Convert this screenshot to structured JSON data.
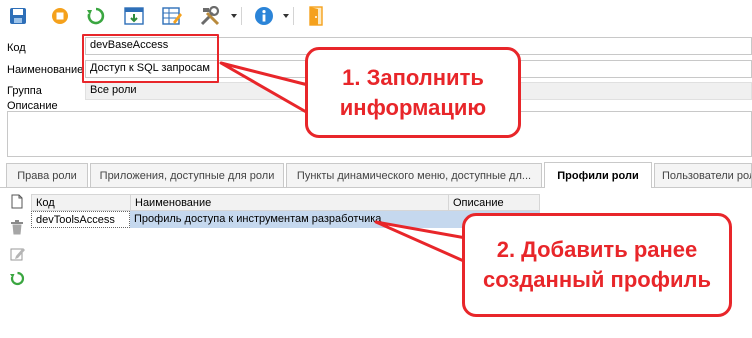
{
  "toolbar": {
    "buttons": [
      {
        "name": "save-icon",
        "color": "#2e6fb8"
      },
      {
        "name": "stop-icon",
        "color": "#f5a11c"
      },
      {
        "name": "refresh-icon",
        "color": "#3aa640"
      },
      {
        "name": "import-icon",
        "color": "#2e8a3a"
      },
      {
        "name": "edit-table-icon",
        "color": "#2e6fb8"
      },
      {
        "name": "tools-icon",
        "color": "#6b6b6b"
      },
      {
        "name": "info-icon",
        "color": "#2b84d8"
      },
      {
        "name": "exit-door-icon",
        "color": "#f5a11c"
      }
    ]
  },
  "form": {
    "code_label": "Код",
    "code_value": "devBaseAccess",
    "name_label": "Наименование",
    "name_value": "Доступ к SQL запросам",
    "group_label": "Группа",
    "group_value": "Все роли",
    "description_label": "Описание",
    "description_value": ""
  },
  "tabs": [
    {
      "label": "Права роли",
      "active": false
    },
    {
      "label": "Приложения, доступные для роли",
      "active": false
    },
    {
      "label": "Пункты динамического меню, доступные дл...",
      "active": false
    },
    {
      "label": "Профили роли",
      "active": true
    },
    {
      "label": "Пользователи роли",
      "active": false
    }
  ],
  "side_actions": [
    "new-document-icon",
    "delete-icon",
    "edit-icon",
    "refresh-icon"
  ],
  "grid": {
    "columns": [
      "Код",
      "Наименование",
      "Описание"
    ],
    "rows": [
      {
        "code": "devToolsAccess",
        "name": "Профиль доступа к инструментам разработчика",
        "description": ""
      }
    ]
  },
  "callouts": {
    "first": {
      "line1": "1. Заполнить",
      "line2": "информацию"
    },
    "second": {
      "line1": "2. Добавить ранее",
      "line2": "созданный профиль"
    }
  },
  "colors": {
    "accent_red": "#e8262a",
    "selection": "#c5d8ee"
  }
}
